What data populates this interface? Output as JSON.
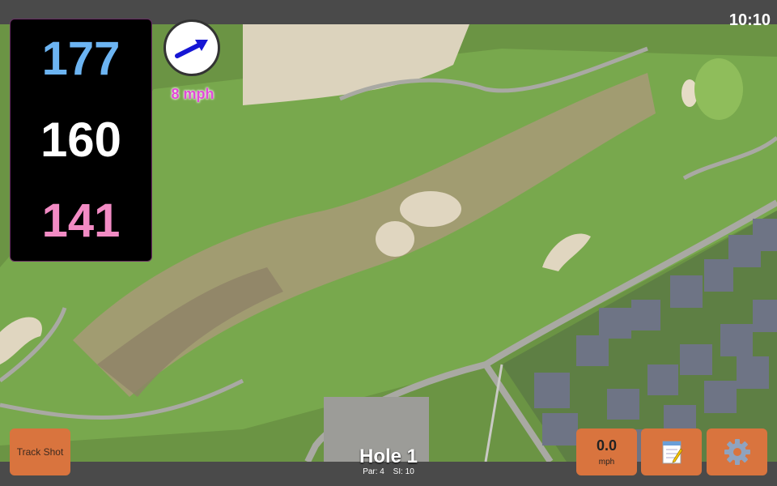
{
  "status": {
    "time": "10:10"
  },
  "distances": {
    "front": "177",
    "middle": "160",
    "back": "141"
  },
  "wind": {
    "speed_label": "8 mph",
    "icon": "wind-arrow-icon"
  },
  "buttons": {
    "track_shot": "Track Shot",
    "speed_value": "0.0",
    "speed_unit": "mph",
    "notes_icon": "notepad-icon",
    "settings_icon": "gear-icon"
  },
  "hole": {
    "title": "Hole 1",
    "par": "Par: 4",
    "si": "SI: 10"
  },
  "colors": {
    "accent": "#d9743e",
    "front_yardage": "#6cb4f2",
    "middle_yardage": "#ffffff",
    "back_yardage": "#f28bc4",
    "wind_speed": "#e24ad8"
  }
}
